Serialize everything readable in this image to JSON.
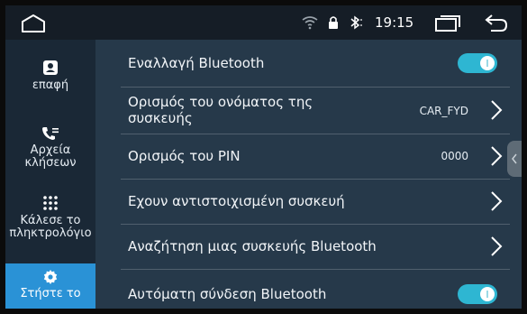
{
  "status_bar": {
    "time": "19:15",
    "icons": [
      "home-icon",
      "wifi-icon",
      "lock-icon",
      "bluetooth-icon",
      "recents-icon",
      "back-icon"
    ]
  },
  "sidebar": {
    "items": [
      {
        "label": "επαφή",
        "icon": "contact-card-icon",
        "active": false
      },
      {
        "label": "Αρχεία κλήσεων",
        "icon": "call-log-icon",
        "active": false
      },
      {
        "label": "Κάλεσε το πληκτρολόγιο",
        "icon": "keypad-icon",
        "active": false
      },
      {
        "label": "Στήστε το",
        "icon": "gear-icon",
        "active": true
      }
    ]
  },
  "settings": {
    "bluetooth_toggle": {
      "label": "Εναλλαγή Bluetooth",
      "on": true
    },
    "device_name": {
      "label": "Ορισμός του ονόματος της συσκευής",
      "value": "CAR_FYD"
    },
    "pin": {
      "label": "Ορισμός του PIN",
      "value": "0000"
    },
    "paired_devices": {
      "label": "Εχουν αντιστοιχισμένη συσκευή"
    },
    "search_device": {
      "label": "Αναζήτηση μιας συσκευής Bluetooth"
    },
    "auto_connect": {
      "label": "Αυτόματη σύνδεση Bluetooth",
      "on": true
    }
  },
  "colors": {
    "accent": "#2a92d6",
    "toggle_on": "#2eb6d2",
    "panel": "#26394a",
    "sidebar": "#1a2836"
  }
}
